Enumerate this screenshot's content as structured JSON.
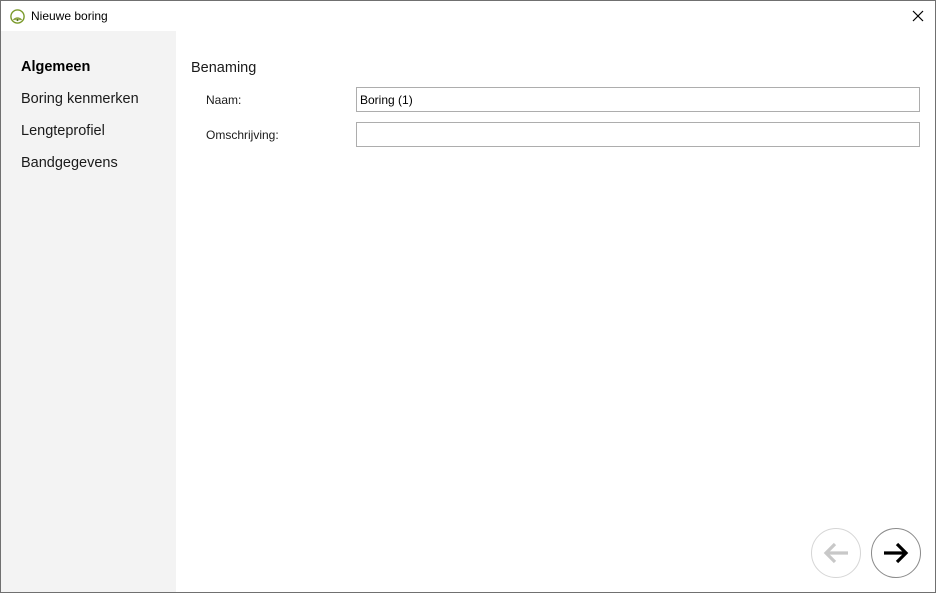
{
  "window": {
    "title": "Nieuwe boring"
  },
  "sidebar": {
    "items": [
      {
        "label": "Algemeen",
        "active": true
      },
      {
        "label": "Boring kenmerken",
        "active": false
      },
      {
        "label": "Lengteprofiel",
        "active": false
      },
      {
        "label": "Bandgegevens",
        "active": false
      }
    ]
  },
  "main": {
    "section_title": "Benaming",
    "fields": {
      "naam": {
        "label": "Naam:",
        "value": "Boring (1)"
      },
      "omschrijving": {
        "label": "Omschrijving:",
        "value": ""
      }
    }
  },
  "navigation": {
    "back_icon": "arrow-left-icon",
    "back_enabled": false,
    "next_icon": "arrow-right-icon",
    "next_enabled": true
  },
  "colors": {
    "sidebar_bg": "#f3f3f3",
    "back_arrow": "#c8c8c8",
    "next_arrow": "#000000",
    "app_icon_green": "#7a9a2a"
  }
}
